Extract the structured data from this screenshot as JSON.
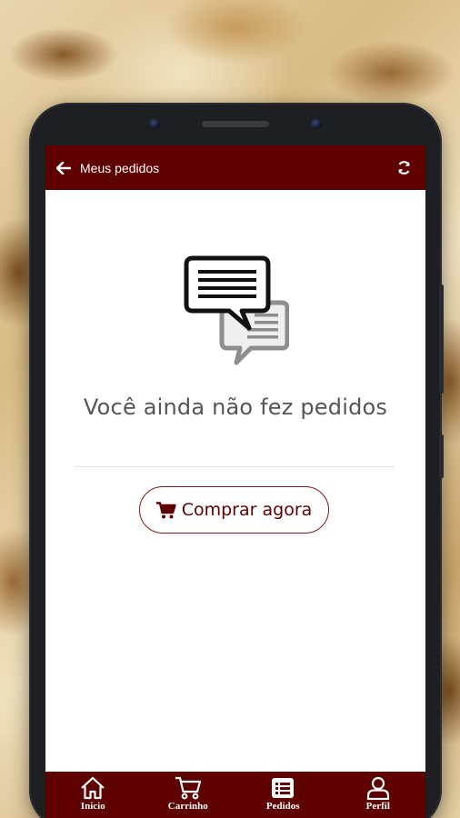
{
  "appbar": {
    "title": "Meus pedidos",
    "back_icon": "arrow-left-icon",
    "refresh_icon": "refresh-icon"
  },
  "empty_state": {
    "illustration_icon": "chat-bubbles-icon",
    "message": "Você ainda não fez pedidos",
    "button_label": "Comprar agora",
    "button_icon": "cart-icon"
  },
  "tabs": [
    {
      "label": "Início",
      "icon": "home-icon"
    },
    {
      "label": "Carrinho",
      "icon": "cart-icon"
    },
    {
      "label": "Pedidos",
      "icon": "list-icon"
    },
    {
      "label": "Perfil",
      "icon": "user-icon"
    }
  ],
  "colors": {
    "brand": "#5e0000",
    "text_muted": "#555555"
  }
}
